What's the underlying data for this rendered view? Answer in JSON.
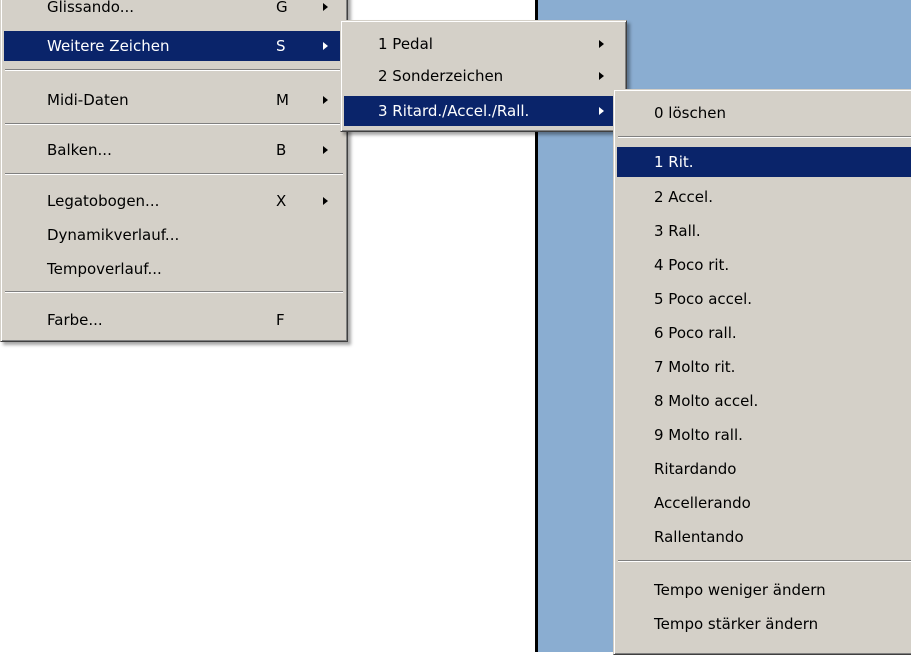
{
  "menu_main": {
    "items": [
      {
        "label": "Glissando...",
        "key": "G",
        "arrow": true
      },
      {
        "label": "Weitere Zeichen",
        "key": "S",
        "arrow": true
      },
      {
        "label": "Midi-Daten",
        "key": "M",
        "arrow": true
      },
      {
        "label": "Balken...",
        "key": "B",
        "arrow": true
      },
      {
        "label": "Legatobogen...",
        "key": "X",
        "arrow": true
      },
      {
        "label": "Dynamikverlauf...",
        "key": "",
        "arrow": false
      },
      {
        "label": "Tempoverlauf...",
        "key": "",
        "arrow": false
      },
      {
        "label": "Farbe...",
        "key": "F",
        "arrow": false
      }
    ]
  },
  "menu_weitere": {
    "items": [
      {
        "label": "1 Pedal"
      },
      {
        "label": "2 Sonderzeichen"
      },
      {
        "label": "3 Ritard./Accel./Rall."
      }
    ]
  },
  "menu_ritard": {
    "items": [
      {
        "label": "0 löschen"
      },
      {
        "label": "1 Rit."
      },
      {
        "label": "2 Accel."
      },
      {
        "label": "3 Rall."
      },
      {
        "label": "4 Poco rit."
      },
      {
        "label": "5 Poco accel."
      },
      {
        "label": "6 Poco rall."
      },
      {
        "label": "7 Molto rit."
      },
      {
        "label": "8 Molto accel."
      },
      {
        "label": "9 Molto rall."
      },
      {
        "label": "Ritardando"
      },
      {
        "label": "Accellerando"
      },
      {
        "label": "Rallentando"
      },
      {
        "label": "Tempo weniger ändern"
      },
      {
        "label": "Tempo stärker ändern"
      }
    ]
  },
  "colors": {
    "menu_bg": "#d4d0c8",
    "highlight": "#0a246a",
    "desktop_blue": "#8aadd1"
  }
}
